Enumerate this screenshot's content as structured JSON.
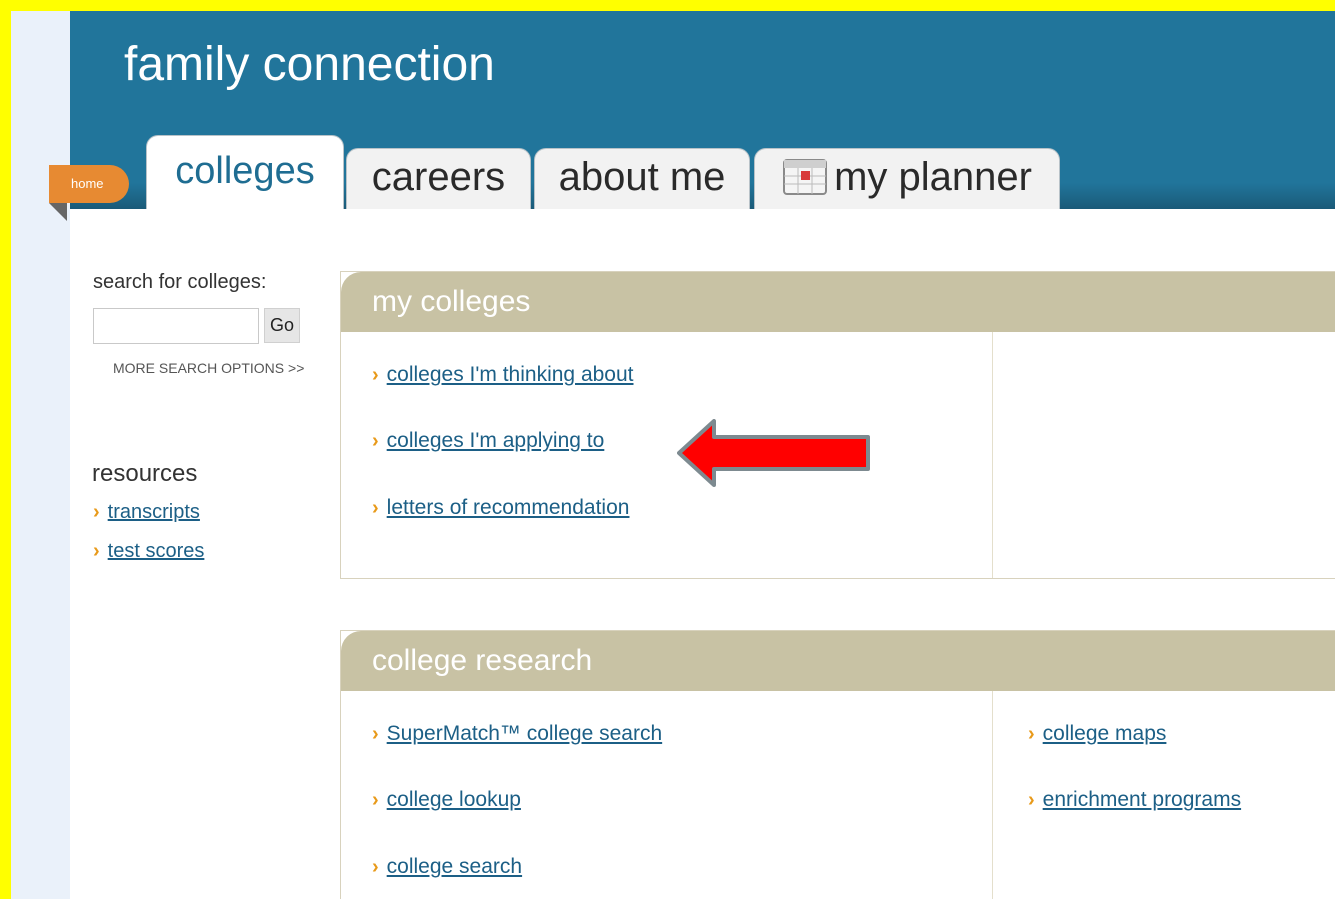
{
  "header": {
    "site_title": "family connection",
    "home_label": "home"
  },
  "tabs": [
    {
      "label": "colleges",
      "active": true
    },
    {
      "label": "careers",
      "active": false
    },
    {
      "label": "about me",
      "active": false
    },
    {
      "label": "my planner",
      "active": false,
      "icon": "calendar-icon"
    }
  ],
  "sidebar": {
    "search_label": "search for colleges:",
    "search_value": "",
    "go_label": "Go",
    "more_options": "MORE SEARCH OPTIONS >>",
    "resources_heading": "resources",
    "resources": [
      "transcripts",
      "test scores"
    ]
  },
  "my_colleges": {
    "title": "my colleges",
    "links": [
      "colleges I'm thinking about",
      "colleges I'm applying to",
      "letters of recommendation"
    ]
  },
  "college_research": {
    "title": "college research",
    "left_links": [
      "SuperMatch™ college search",
      "college lookup",
      "college search"
    ],
    "right_links": [
      "college maps",
      "enrichment programs"
    ]
  },
  "colors": {
    "frame_border": "#ffff00",
    "header_bg": "#21759b",
    "home_tab": "#e78a32",
    "panel_header": "#c8c2a4",
    "link": "#1c5f86",
    "chevron": "#e89a1a",
    "annotation_arrow": "#ff0000"
  },
  "annotation": {
    "icon": "red-arrow-icon"
  }
}
